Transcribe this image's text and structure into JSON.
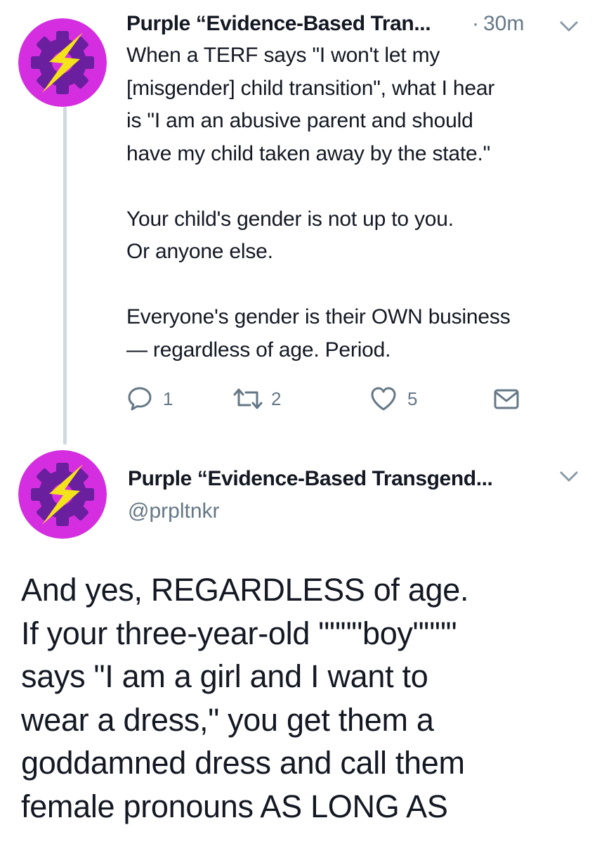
{
  "tweet1": {
    "display_name": "Purple “Evidence-Based Tran...",
    "dot": "·",
    "time": "30m",
    "avatar_icon": "gear-lightning-logo",
    "text": "When a TERF says \"I won't let my\n[misgender] child transition\", what I hear\nis \"I am an abusive parent and should\nhave my child taken away by the state.\"\n\nYour child's gender is not up to you.\nOr anyone else.\n\nEveryone's gender is their OWN business\n— regardless of age. Period.",
    "actions": {
      "reply_count": "1",
      "retweet_count": "2",
      "like_count": "5"
    }
  },
  "tweet2": {
    "display_name": "Purple “Evidence-Based Transgend...",
    "handle": "@prpltnkr",
    "avatar_icon": "gear-lightning-logo",
    "text": "And yes, REGARDLESS of age.\nIf your three-year-old \"\"\"\"boy\"\"\"\"\nsays \"I am a girl and I want to\nwear a dress,\" you get them a\ngoddamned dress and call them\nfemale pronouns AS LONG AS"
  },
  "colors": {
    "avatar_bg": "#d42ee0",
    "gear": "#6a1f9e",
    "bolt": "#f4e21b",
    "secondary_text": "#657786",
    "thread_line": "#cfd9de"
  }
}
